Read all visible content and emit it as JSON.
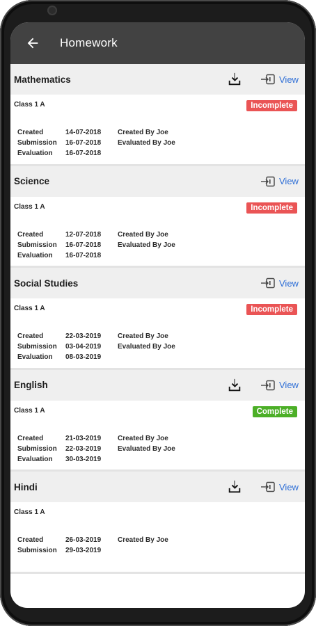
{
  "appbar": {
    "title": "Homework"
  },
  "labels": {
    "created": "Created",
    "submission": "Submission",
    "evaluation": "Evaluation",
    "created_by": "Created By",
    "evaluated_by": "Evaluated By",
    "view": "View"
  },
  "colors": {
    "appbar": "#424242",
    "incomplete": "#ea5455",
    "complete": "#4caf27",
    "link": "#2f6fd6"
  },
  "homework": [
    {
      "subject": "Mathematics",
      "class": "Class 1 A",
      "status": "Incomplete",
      "has_download": true,
      "created": "14-07-2018",
      "submission": "16-07-2018",
      "evaluation": "16-07-2018",
      "created_by": "Joe",
      "evaluated_by": "Joe"
    },
    {
      "subject": "Science",
      "class": "Class 1 A",
      "status": "Incomplete",
      "has_download": false,
      "created": "12-07-2018",
      "submission": "16-07-2018",
      "evaluation": "16-07-2018",
      "created_by": "Joe",
      "evaluated_by": "Joe"
    },
    {
      "subject": "Social Studies",
      "class": "Class 1 A",
      "status": "Incomplete",
      "has_download": false,
      "created": "22-03-2019",
      "submission": "03-04-2019",
      "evaluation": "08-03-2019",
      "created_by": "Joe",
      "evaluated_by": "Joe"
    },
    {
      "subject": "English",
      "class": "Class 1 A",
      "status": "Complete",
      "has_download": true,
      "created": "21-03-2019",
      "submission": "22-03-2019",
      "evaluation": "30-03-2019",
      "created_by": "Joe",
      "evaluated_by": "Joe"
    },
    {
      "subject": "Hindi",
      "class": "Class 1 A",
      "status": "",
      "has_download": true,
      "created": "26-03-2019",
      "submission": "29-03-2019",
      "evaluation": "",
      "created_by": "Joe",
      "evaluated_by": ""
    }
  ]
}
